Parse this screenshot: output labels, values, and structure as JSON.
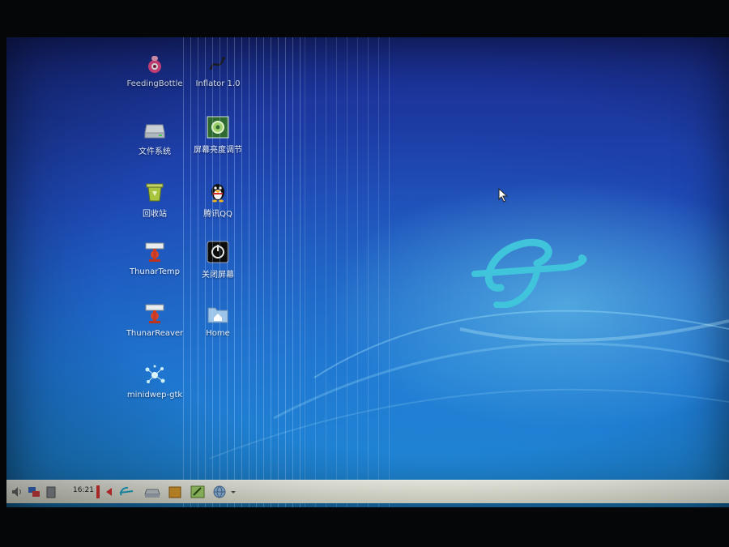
{
  "desktop": {
    "icons": [
      {
        "label": "FeedingBottle",
        "icon": "feeding-bottle-icon"
      },
      {
        "label": "Inflator 1.0",
        "icon": "inflator-icon"
      },
      {
        "label": "文件系统",
        "icon": "drive-icon"
      },
      {
        "label": "屏幕亮度调节",
        "icon": "brightness-icon"
      },
      {
        "label": "回收站",
        "icon": "trash-icon"
      },
      {
        "label": "腾讯QQ",
        "icon": "qq-penguin-icon"
      },
      {
        "label": "ThunarTemp",
        "icon": "thunar-icon"
      },
      {
        "label": "关闭屏幕",
        "icon": "screen-off-icon"
      },
      {
        "label": "ThunarReaver",
        "icon": "thunar-icon"
      },
      {
        "label": "Home",
        "icon": "home-folder-icon"
      },
      {
        "label": "minidwep-gtk",
        "icon": "minidwep-icon"
      }
    ]
  },
  "taskbar": {
    "clock": "16:21"
  },
  "colors": {
    "accent": "#3fc4dc",
    "taskbar_bg": "#e4e6da",
    "desktop_top": "#1a2c8f",
    "desktop_bottom": "#1b88d2"
  }
}
